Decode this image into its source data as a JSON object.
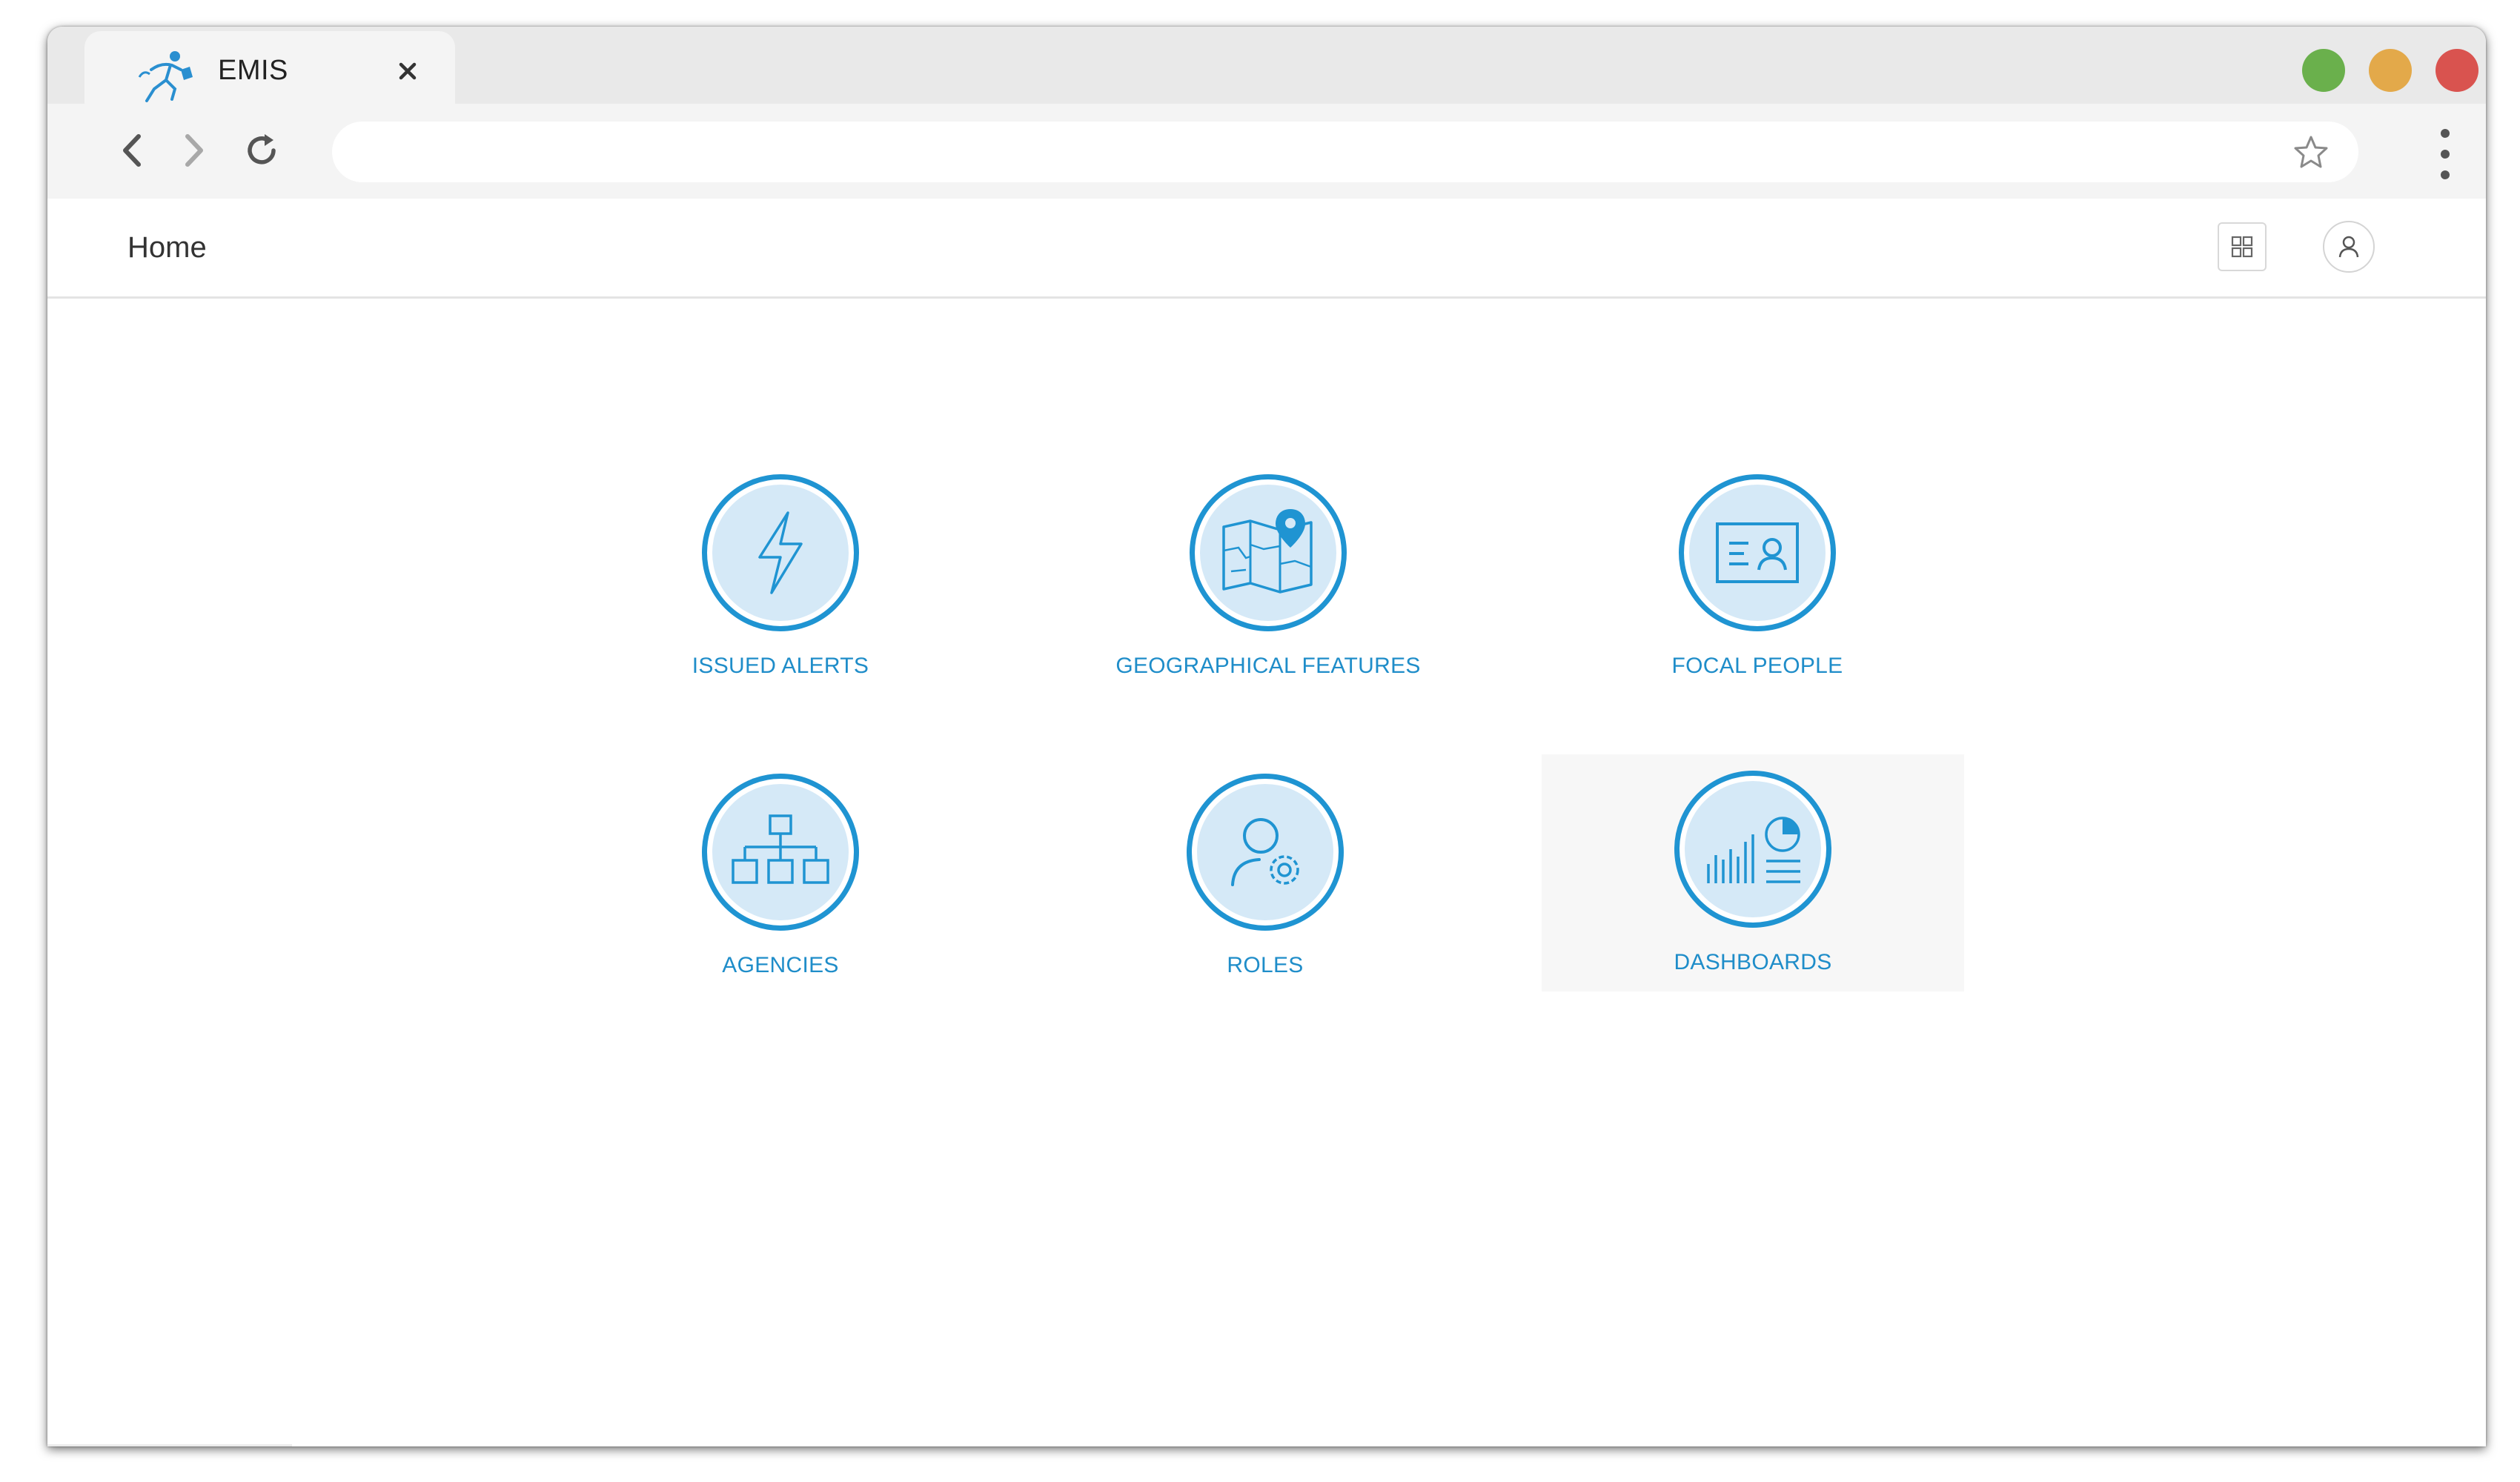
{
  "browser": {
    "tab_title": "EMIS",
    "tab_close": "×",
    "address_value": "",
    "window_controls": {
      "green": "#6ab04c",
      "orange": "#e3a94a",
      "red": "#d9534f"
    }
  },
  "app": {
    "page_title": "Home",
    "accent": "#1f94d2"
  },
  "tiles": [
    {
      "label": "ISSUED ALERTS",
      "icon": "lightning-icon"
    },
    {
      "label": "GEOGRAPHICAL FEATURES",
      "icon": "map-icon"
    },
    {
      "label": "FOCAL PEOPLE",
      "icon": "id-card-icon"
    },
    {
      "label": "AGENCIES",
      "icon": "org-chart-icon"
    },
    {
      "label": "ROLES",
      "icon": "user-settings-icon"
    },
    {
      "label": "DASHBOARDS",
      "icon": "chart-icon"
    }
  ]
}
